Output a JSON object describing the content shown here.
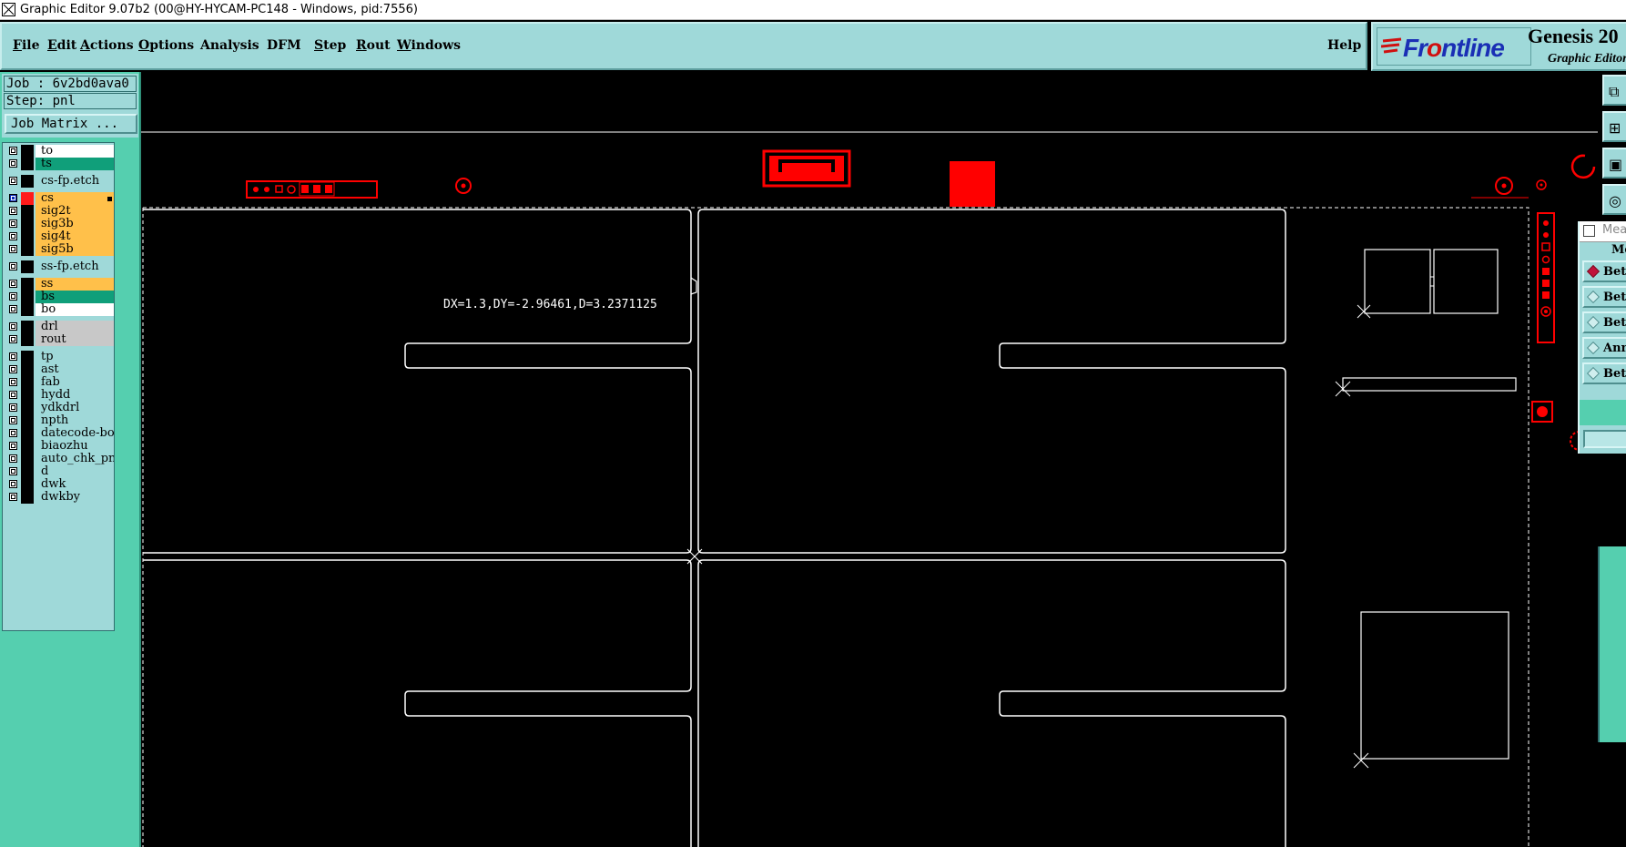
{
  "window": {
    "title": "Graphic Editor 9.07b2 (00@HY-HYCAM-PC148 - Windows, pid:7556)"
  },
  "menu": {
    "items": [
      {
        "first": "F",
        "rest": "ile"
      },
      {
        "first": "E",
        "rest": "dit"
      },
      {
        "first": "A",
        "rest": "ctions"
      },
      {
        "first": "O",
        "rest": "ptions"
      },
      {
        "first": "",
        "rest": "Analysis"
      },
      {
        "first": "",
        "rest": "DFM"
      },
      {
        "first": "S",
        "rest": "tep"
      },
      {
        "first": "R",
        "rest": "out"
      },
      {
        "first": "W",
        "rest": "indows"
      }
    ],
    "help": "Help"
  },
  "brand": {
    "logo_pre": "Fr",
    "logo_o": "o",
    "logo_post": "ntline",
    "product": "Genesis 20",
    "subtitle": "Graphic Editor"
  },
  "job": {
    "job_line": "Job : 6v2bd0ava0",
    "step_line": "Step: pnl",
    "matrix_button": "Job Matrix ..."
  },
  "layers": [
    {
      "name": "to",
      "bg": "#ffffff",
      "checked": false,
      "swatch": "#000000"
    },
    {
      "name": "ts",
      "bg": "#109f7a",
      "checked": false,
      "swatch": "#000000"
    },
    {
      "name": "cs-fp.etch",
      "bg": "#9fd9d9",
      "checked": false,
      "swatch": "#000000"
    },
    {
      "name": "cs",
      "bg": "#ffc04a",
      "checked": true,
      "swatch": "#ff1a1a",
      "marker": true
    },
    {
      "name": "sig2t",
      "bg": "#ffc04a",
      "checked": false,
      "swatch": "#000000"
    },
    {
      "name": "sig3b",
      "bg": "#ffc04a",
      "checked": false,
      "swatch": "#000000"
    },
    {
      "name": "sig4t",
      "bg": "#ffc04a",
      "checked": false,
      "swatch": "#000000"
    },
    {
      "name": "sig5b",
      "bg": "#ffc04a",
      "checked": false,
      "swatch": "#000000"
    },
    {
      "name": "ss-fp.etch",
      "bg": "#9fd9d9",
      "checked": false,
      "swatch": "#000000"
    },
    {
      "name": "ss",
      "bg": "#ffc04a",
      "checked": false,
      "swatch": "#000000"
    },
    {
      "name": "bs",
      "bg": "#109f7a",
      "checked": false,
      "swatch": "#000000"
    },
    {
      "name": "bo",
      "bg": "#ffffff",
      "checked": false,
      "swatch": "#000000"
    },
    {
      "name": "drl",
      "bg": "#c8c8c8",
      "checked": false,
      "swatch": "#000000"
    },
    {
      "name": "rout",
      "bg": "#c8c8c8",
      "checked": false,
      "swatch": "#000000"
    },
    {
      "name": "tp",
      "bg": "#9fd9d9",
      "checked": false,
      "swatch": "#000000"
    },
    {
      "name": "ast",
      "bg": "#9fd9d9",
      "checked": false,
      "swatch": "#000000"
    },
    {
      "name": "fab",
      "bg": "#9fd9d9",
      "checked": false,
      "swatch": "#000000"
    },
    {
      "name": "hydd",
      "bg": "#9fd9d9",
      "checked": false,
      "swatch": "#000000"
    },
    {
      "name": "ydkdrl",
      "bg": "#9fd9d9",
      "checked": false,
      "swatch": "#000000"
    },
    {
      "name": "npth",
      "bg": "#9fd9d9",
      "checked": false,
      "swatch": "#000000"
    },
    {
      "name": "datecode-bo",
      "bg": "#9fd9d9",
      "checked": false,
      "swatch": "#000000"
    },
    {
      "name": "biaozhu",
      "bg": "#9fd9d9",
      "checked": false,
      "swatch": "#000000"
    },
    {
      "name": "auto_chk_pnl",
      "bg": "#9fd9d9",
      "checked": false,
      "swatch": "#000000"
    },
    {
      "name": "d",
      "bg": "#9fd9d9",
      "checked": false,
      "swatch": "#000000"
    },
    {
      "name": "dwk",
      "bg": "#9fd9d9",
      "checked": false,
      "swatch": "#000000"
    },
    {
      "name": "dwkby",
      "bg": "#9fd9d9",
      "checked": false,
      "swatch": "#000000"
    }
  ],
  "canvas": {
    "measurement": "DX=1.3,DY=-2.96461,D=3.2371125"
  },
  "tools": [
    {
      "icon": "snapshot-icon",
      "glyph": "⧉"
    },
    {
      "icon": "zoom-in-icon",
      "glyph": "⊞"
    },
    {
      "icon": "fit-window-icon",
      "glyph": "▣"
    },
    {
      "icon": "view-icon",
      "glyph": "◎"
    }
  ],
  "measure_popup": {
    "title": "Measure",
    "header": "Measure",
    "options": [
      {
        "label": "Between",
        "selected": true
      },
      {
        "label": "Between",
        "selected": false
      },
      {
        "label": "Between",
        "selected": false
      },
      {
        "label": "Annular",
        "selected": false
      },
      {
        "label": "Between",
        "selected": false
      }
    ]
  },
  "colors": {
    "panel": "#9fd9d9",
    "panel_green": "#55cfaf",
    "layer_active": "#ff0000",
    "outline": "#ffffff"
  }
}
